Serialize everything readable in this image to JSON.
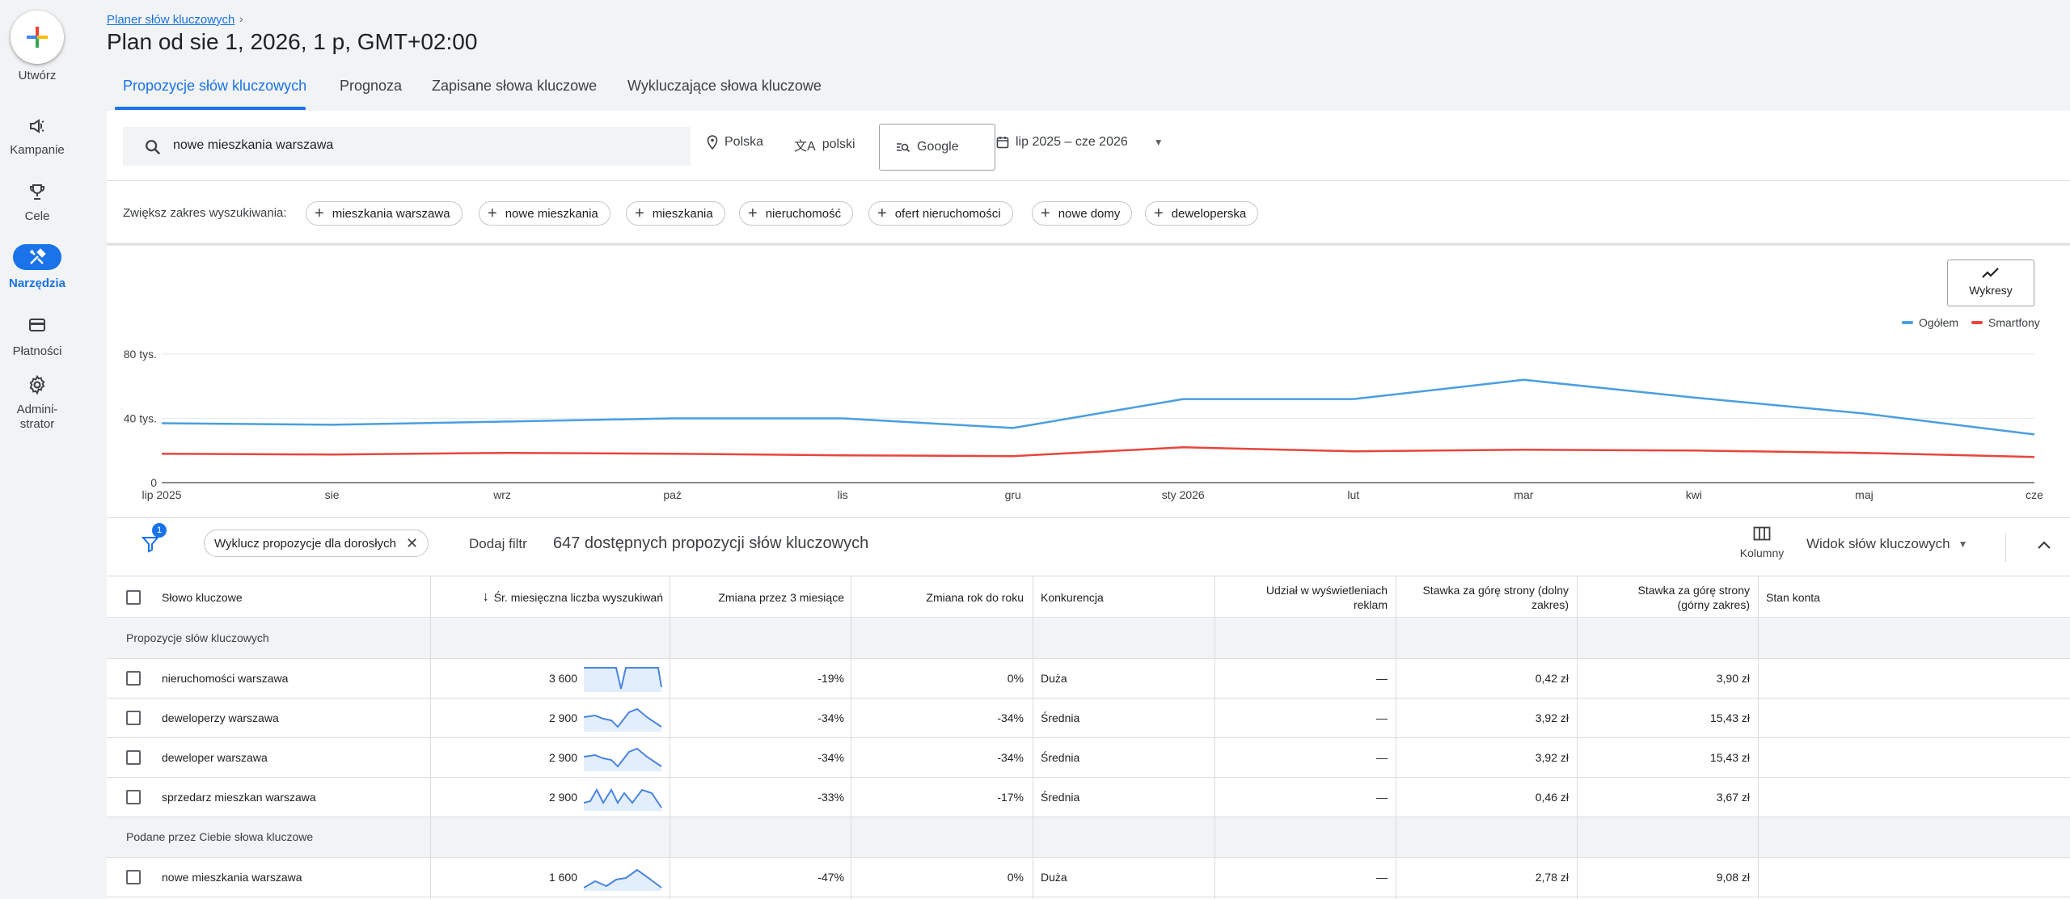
{
  "nav": {
    "create_label": "Utwórz",
    "items": [
      {
        "label": "Kampanie",
        "icon": "megaphone-icon"
      },
      {
        "label": "Cele",
        "icon": "trophy-icon"
      },
      {
        "label": "Narzędzia",
        "icon": "tools-icon",
        "active": true
      },
      {
        "label": "Płatności",
        "icon": "credit-card-icon"
      },
      {
        "label": "Admini-",
        "label2": "strator",
        "icon": "gear-icon"
      }
    ]
  },
  "header": {
    "breadcrumb": "Planer słów kluczowych",
    "title": "Plan od sie 1, 2026, 1 p, GMT+02:00"
  },
  "tabs": [
    "Propozycje słów kluczowych",
    "Prognoza",
    "Zapisane słowa kluczowe",
    "Wykluczające słowa kluczowe"
  ],
  "search": {
    "value": "nowe mieszkania warszawa",
    "location": "Polska",
    "language": "polski",
    "network": "Google",
    "date_range": "lip 2025 – cze 2026"
  },
  "broaden": {
    "label": "Zwiększ zakres wyszukiwania:",
    "chips": [
      "mieszkania warszawa",
      "nowe mieszkania",
      "mieszkania",
      "nieruchomość",
      "ofert nieruchomości",
      "nowe domy",
      "deweloperska"
    ]
  },
  "chart_controls": {
    "button_label": "Wykresy",
    "legend": [
      {
        "name": "Ogółem",
        "color": "#4a9ee0"
      },
      {
        "name": "Smartfony",
        "color": "#e8453c"
      }
    ]
  },
  "chart_data": {
    "type": "line",
    "x": [
      "lip 2025",
      "sie",
      "wrz",
      "paź",
      "lis",
      "gru",
      "sty 2026",
      "lut",
      "mar",
      "kwi",
      "maj",
      "cze"
    ],
    "yticks": [
      "0",
      "40 tys.",
      "80 tys."
    ],
    "ylim": [
      0,
      80000
    ],
    "grid": true,
    "legend_position": "top-right",
    "series": [
      {
        "name": "Ogółem",
        "values": [
          37000,
          36000,
          38000,
          40000,
          40000,
          34000,
          52000,
          52000,
          64000,
          53000,
          43000,
          30000
        ]
      },
      {
        "name": "Smartfony",
        "values": [
          18000,
          17500,
          18500,
          18000,
          17000,
          16500,
          22000,
          19500,
          20500,
          20000,
          18500,
          16000
        ]
      }
    ]
  },
  "filters": {
    "badge": "1",
    "chip": "Wyklucz propozycje dla dorosłych",
    "add_filter": "Dodaj filtr",
    "count": "647 dostępnych propozycji słów kluczowych",
    "columns_label": "Kolumny",
    "view_label": "Widok słów kluczowych"
  },
  "table": {
    "headers": {
      "keyword": "Słowo kluczowe",
      "avg": "Śr. miesięczna liczba wyszukiwań",
      "change3": "Zmiana przez 3 miesiące",
      "yoy": "Zmiana rok do roku",
      "competition": "Konkurencja",
      "impr1": "Udział w wyświetleniach",
      "impr2": "reklam",
      "bidlow1": "Stawka za górę strony (dolny",
      "bidlow2": "zakres)",
      "bidhigh1": "Stawka za górę strony",
      "bidhigh2": "(górny zakres)",
      "status": "Stan konta"
    },
    "group1": "Propozycje słów kluczowych",
    "group2": "Podane przez Ciebie słowa kluczowe",
    "rows": [
      {
        "keyword": "nieruchomości warszawa",
        "avg": "3 600",
        "change3": "-19%",
        "yoy": "0%",
        "competition": "Duża",
        "impr": "—",
        "bidlow": "0,42 zł",
        "bidhigh": "3,90 zł"
      },
      {
        "keyword": "deweloperzy warszawa",
        "avg": "2 900",
        "change3": "-34%",
        "yoy": "-34%",
        "competition": "Średnia",
        "impr": "—",
        "bidlow": "3,92 zł",
        "bidhigh": "15,43 zł"
      },
      {
        "keyword": "deweloper warszawa",
        "avg": "2 900",
        "change3": "-34%",
        "yoy": "-34%",
        "competition": "Średnia",
        "impr": "—",
        "bidlow": "3,92 zł",
        "bidhigh": "15,43 zł"
      },
      {
        "keyword": "sprzedarz mieszkan warszawa",
        "avg": "2 900",
        "change3": "-33%",
        "yoy": "-17%",
        "competition": "Średnia",
        "impr": "—",
        "bidlow": "0,46 zł",
        "bidhigh": "3,67 zł"
      },
      {
        "keyword": "nowe mieszkania warszawa",
        "avg": "1 600",
        "change3": "-47%",
        "yoy": "0%",
        "competition": "Duża",
        "impr": "—",
        "bidlow": "2,78 zł",
        "bidhigh": "9,08 zł"
      }
    ]
  }
}
